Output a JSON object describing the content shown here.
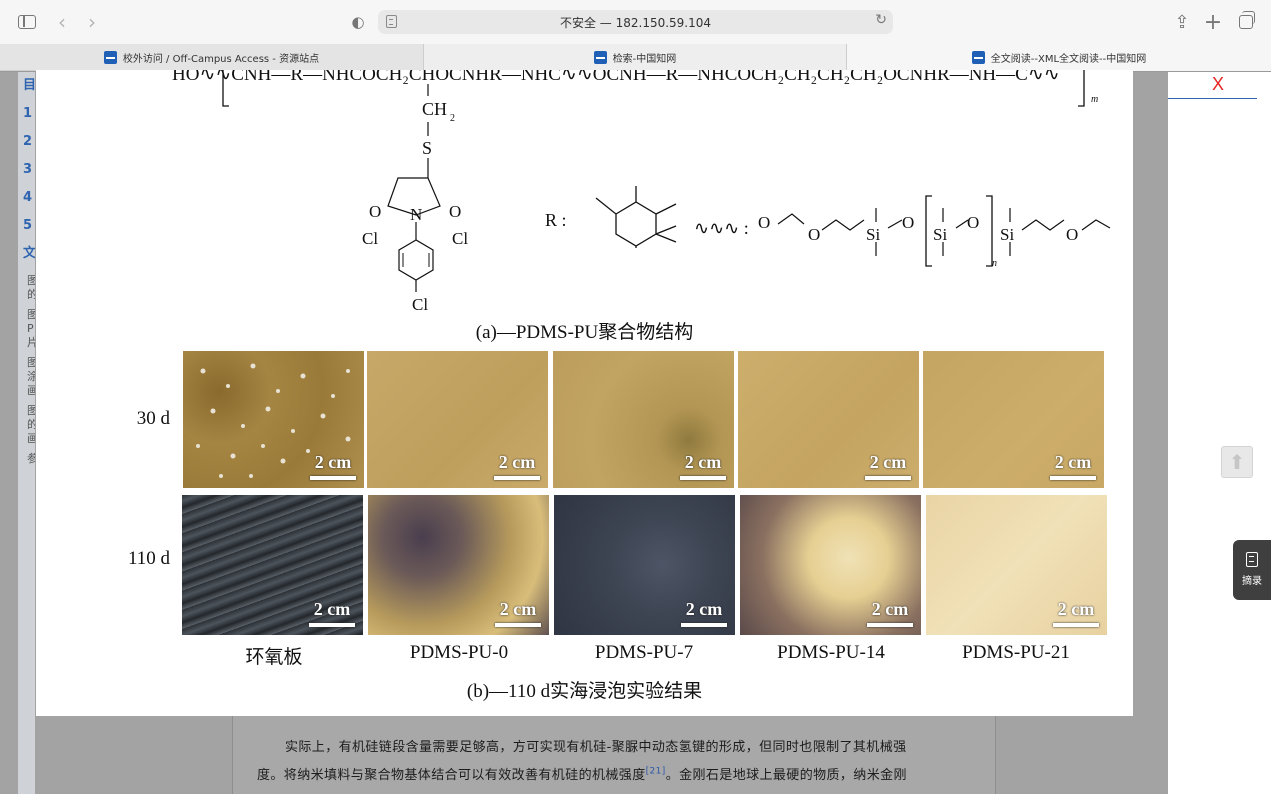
{
  "browser": {
    "address": "不安全 — 182.150.59.104",
    "tabs": [
      {
        "label": "校外访问 / Off-Campus Access - 资源站点"
      },
      {
        "label": "检索-中国知网"
      },
      {
        "label": "全文阅读--XML全文阅读--中国知网"
      }
    ]
  },
  "toc": {
    "items": [
      "目",
      "1",
      "2",
      "3",
      "4",
      "5",
      "文"
    ],
    "subs": [
      "图的",
      "图P片",
      "图涂画",
      "图的画"
    ],
    "refs": "参"
  },
  "right_panel": {
    "close": "X",
    "abstract_label": "摘录",
    "back_top_icon": "arrow-up-icon"
  },
  "figure": {
    "caption_a": "(a)—PDMS-PU聚合物结构",
    "caption_b": "(b)—110 d实海浸泡实验结果",
    "rows": [
      "30 d",
      "110 d"
    ],
    "columns": [
      "环氧板",
      "PDMS-PU-0",
      "PDMS-PU-7",
      "PDMS-PU-14",
      "PDMS-PU-21"
    ],
    "scale_label": "2 cm",
    "chem": {
      "chain_top": "HO∿∿CNH—R—NHCOCH₂CHOCNHR—NHC∿∿OCNH—R—NHCOCH₂CH₂CH₂CH₂OCNHR—NH—C∿∿",
      "sub_m": "m",
      "ch2": "CH",
      "ch2_sub": "2",
      "s": "S",
      "o": "O",
      "n": "N",
      "cl": "Cl",
      "r_label": "R :",
      "wavy_label": "∿∿∿ :",
      "si": "Si",
      "sub_n": "n"
    }
  },
  "article": {
    "line1": "实际上，有机硅链段含量需要足够高，方可实现有机硅-聚脲中动态氢键的形成，但同时也限制了其机械强",
    "line2_pre": "度。将纳米填料与聚合物基体结合可以有效改善有机硅的机械强度",
    "line2_ref": "[21]",
    "line2_post": "。金刚石是地球上最硬的物质，纳米金刚"
  }
}
